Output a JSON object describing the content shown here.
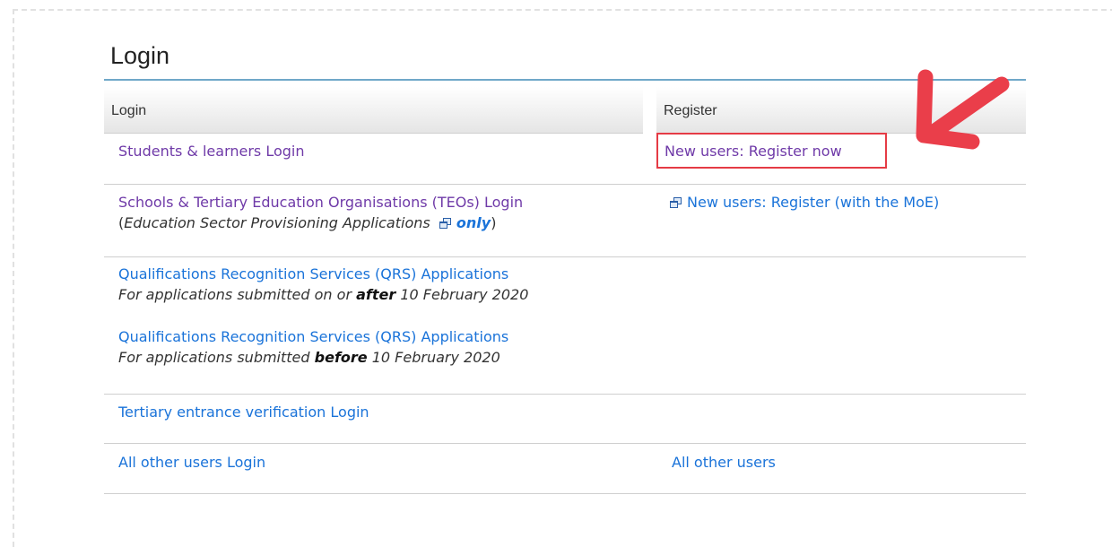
{
  "title": "Login",
  "headers": {
    "login": "Login",
    "register": "Register"
  },
  "rows": {
    "students": {
      "login": "Students & learners Login",
      "register": "New users: Register now"
    },
    "schools": {
      "login": "Schools & Tertiary Education Organisations (TEOs) Login",
      "sub_open": "(",
      "sub_text": "Education Sector Provisioning Applications",
      "sub_only": "only",
      "sub_close": ")",
      "register": "New users: Register (with the MoE)"
    },
    "qrs_after": {
      "login": "Qualifications Recognition Services (QRS) Applications",
      "sub_pre": "For applications submitted on or ",
      "sub_bold": "after",
      "sub_post": " 10 February 2020"
    },
    "qrs_before": {
      "login": "Qualifications Recognition Services (QRS) Applications",
      "sub_pre": "For applications submitted ",
      "sub_bold": "before",
      "sub_post": " 10 February 2020"
    },
    "tertiary": {
      "login": "Tertiary entrance verification Login"
    },
    "others": {
      "login": "All other users Login",
      "register": "All other users"
    }
  },
  "colors": {
    "visited_link": "#6f3aa8",
    "link": "#1a73d9",
    "highlight": "#e53b45",
    "rule": "#6fa8c9"
  },
  "icons": {
    "external_window": "new-window-icon",
    "annotation_arrow": "red-arrow-icon"
  }
}
